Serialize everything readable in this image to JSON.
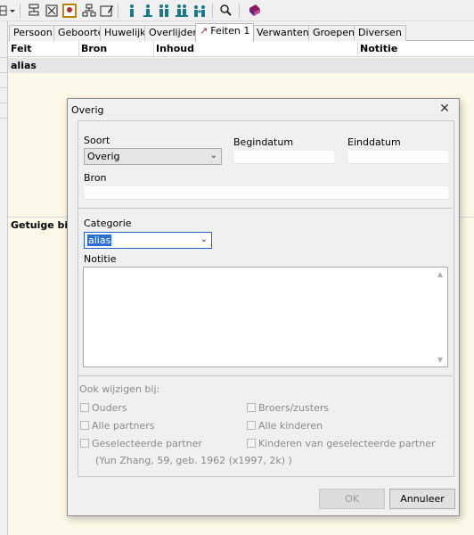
{
  "toolbar": {
    "icons": [
      "grid-icon",
      "dropdown-icon",
      "tree-icon",
      "tree-cross-icon",
      "portrait-icon",
      "family-icon",
      "family-edit-icon",
      "person-icon",
      "person-2-icon",
      "persons-icon",
      "persons-2-icon",
      "persons-3-icon",
      "search-icon",
      "book-icon"
    ]
  },
  "tabs": [
    {
      "label": "Persoon"
    },
    {
      "label": "Geboorte"
    },
    {
      "label": "Huwelijk"
    },
    {
      "label": "Overlijden"
    },
    {
      "label": "Feiten 1",
      "active": true
    },
    {
      "label": "Verwanten"
    },
    {
      "label": "Groepen"
    },
    {
      "label": "Diversen"
    }
  ],
  "grid": {
    "columns": [
      "Feit",
      "Bron",
      "Inhoud",
      "Notitie"
    ],
    "rows": [
      [
        "alias",
        "",
        "",
        ""
      ]
    ],
    "witness_label": "Getuige bij:"
  },
  "dialog": {
    "title": "Overig",
    "close_glyph": "✕",
    "soort_label": "Soort",
    "soort_value": "Overig",
    "begindatum_label": "Begindatum",
    "begindatum_value": "",
    "einddatum_label": "Einddatum",
    "einddatum_value": "",
    "bron_label": "Bron",
    "bron_value": "",
    "categorie_label": "Categorie",
    "categorie_value": "alias",
    "notitie_label": "Notitie",
    "notitie_value": "",
    "also_change_label": "Ook wijzigen bij:",
    "checks": {
      "ouders": "Ouders",
      "broers": "Broers/zusters",
      "alle_partners": "Alle partners",
      "alle_kinderen": "Alle kinderen",
      "gesel_partner": "Geselecteerde partner",
      "kinderen_gesel": "Kinderen van geselecteerde partner"
    },
    "partner_info": "(Yun Zhang, 59, geb. 1962 (x1997, 2k) )",
    "ok_label": "OK",
    "cancel_label": "Annuleer"
  },
  "colors": {
    "panel_bg": "#fdf9e8",
    "accent": "#1e63c7",
    "tab_icon": "#c0272d"
  }
}
